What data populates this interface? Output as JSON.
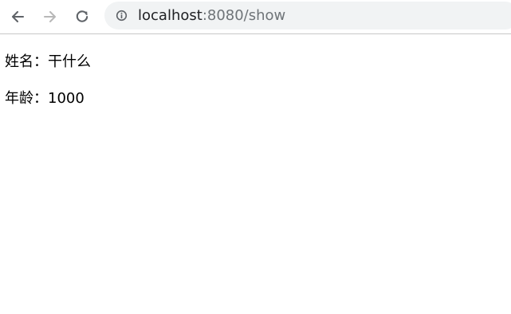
{
  "browser": {
    "url_host": "localhost",
    "url_rest": ":8080/show"
  },
  "fields": [
    {
      "label": "姓名：",
      "value": "干什么"
    },
    {
      "label": "年龄：",
      "value": "1000"
    }
  ],
  "icons": {
    "back": "arrow-left-icon",
    "forward": "arrow-right-icon",
    "reload": "reload-icon",
    "info": "info-icon"
  },
  "colors": {
    "omnibox_bg": "#f1f3f4",
    "url_host": "#202124",
    "url_rest": "#6f7478",
    "forward_disabled": "#b8b8b8"
  }
}
